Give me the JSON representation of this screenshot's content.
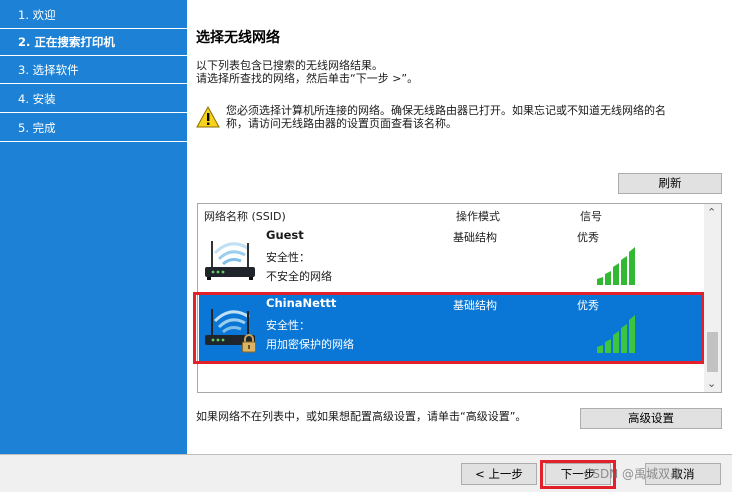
{
  "sidebar": {
    "steps": [
      {
        "label": "1. 欢迎",
        "active": false
      },
      {
        "label": "2. 正在搜索打印机",
        "active": true
      },
      {
        "label": "3. 选择软件",
        "active": false
      },
      {
        "label": "4. 安装",
        "active": false
      },
      {
        "label": "5. 完成",
        "active": false
      }
    ]
  },
  "main": {
    "title": "选择无线网络",
    "intro_line1": "以下列表包含已搜索的无线网络结果。",
    "intro_line2": "请选择所查找的网络，然后单击“下一步 >”。",
    "warning_line1": "您必须选择计算机所连接的网络。确保无线路由器已打开。如果忘记或不知道无线网络的名",
    "warning_line2": "称，请访问无线路由器的设置页面查看该名称。",
    "refresh_label": "刷新",
    "advanced_label": "高级设置",
    "footer_note": "如果网络不在列表中，或如果想配置高级设置，请单击“高级设置”。"
  },
  "netlist": {
    "col_ssid": "网络名称 (SSID)",
    "col_mode": "操作模式",
    "col_signal": "信号",
    "networks": [
      {
        "ssid": "Guest",
        "security_label": "安全性：",
        "security": "不安全的网络",
        "mode": "基础结构",
        "signal": "优秀",
        "locked": false,
        "selected": false
      },
      {
        "ssid": "ChinaNettt",
        "security_label": "安全性：",
        "security": "用加密保护的网络",
        "mode": "基础结构",
        "signal": "优秀",
        "locked": true,
        "selected": true
      }
    ]
  },
  "buttons": {
    "back": "< 上一步",
    "next": "下一步",
    "cancel": "取消"
  },
  "watermark": "CSDN @禹城双鼻",
  "colors": {
    "sidebar": "#1d82d6",
    "selected_row": "#0a76d6",
    "highlight": "#e3212b",
    "signal_green": "#2bb32b"
  },
  "icons": {
    "warning": "warning-triangle-icon",
    "router": "wireless-router-icon",
    "lock": "padlock-icon",
    "signal": "signal-bars-icon"
  }
}
